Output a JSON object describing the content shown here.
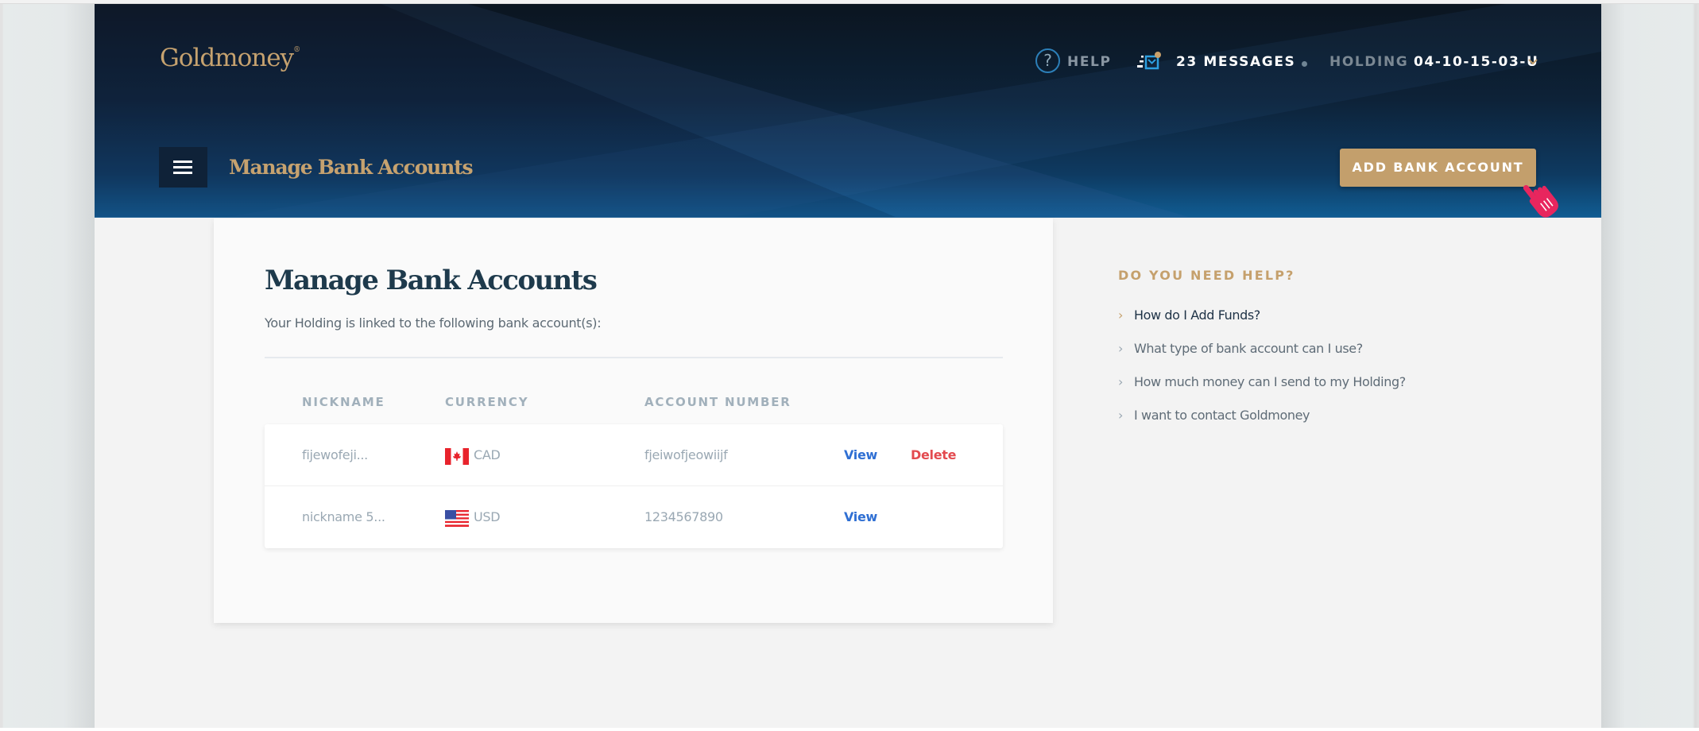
{
  "brand": {
    "name": "Goldmoney",
    "mark": "®"
  },
  "top_nav": {
    "help_label": "HELP",
    "messages_label": "23 MESSAGES",
    "holding_label": "HOLDING",
    "holding_id": "04-10-15-03-U"
  },
  "header": {
    "title": "Manage Bank Accounts",
    "add_button_label": "ADD BANK ACCOUNT"
  },
  "main": {
    "title": "Manage Bank Accounts",
    "subtitle": "Your Holding is linked to the following bank account(s):",
    "columns": [
      "NICKNAME",
      "CURRENCY",
      "ACCOUNT NUMBER"
    ],
    "rows": [
      {
        "nickname": "fijewofeji...",
        "currency": "CAD",
        "flag": "canada-flag",
        "account_number": "fjeiwofjeowiijf",
        "view_label": "View",
        "delete_label": "Delete"
      },
      {
        "nickname": "nickname 5...",
        "currency": "USD",
        "flag": "usa-flag",
        "account_number": "1234567890",
        "view_label": "View"
      }
    ]
  },
  "help": {
    "title": "DO YOU NEED HELP?",
    "items": [
      {
        "label": "How do I Add Funds?",
        "active": true
      },
      {
        "label": "What type of bank account can I use?"
      },
      {
        "label": "How much money can I send to my Holding?"
      },
      {
        "label": "I want to contact Goldmoney"
      }
    ]
  },
  "colors": {
    "gold": "#c6a26f",
    "navy": "#0f2238",
    "link_blue": "#2f6fd3",
    "delete_red": "#e34a4f",
    "cursor_pink": "#e8265e"
  }
}
